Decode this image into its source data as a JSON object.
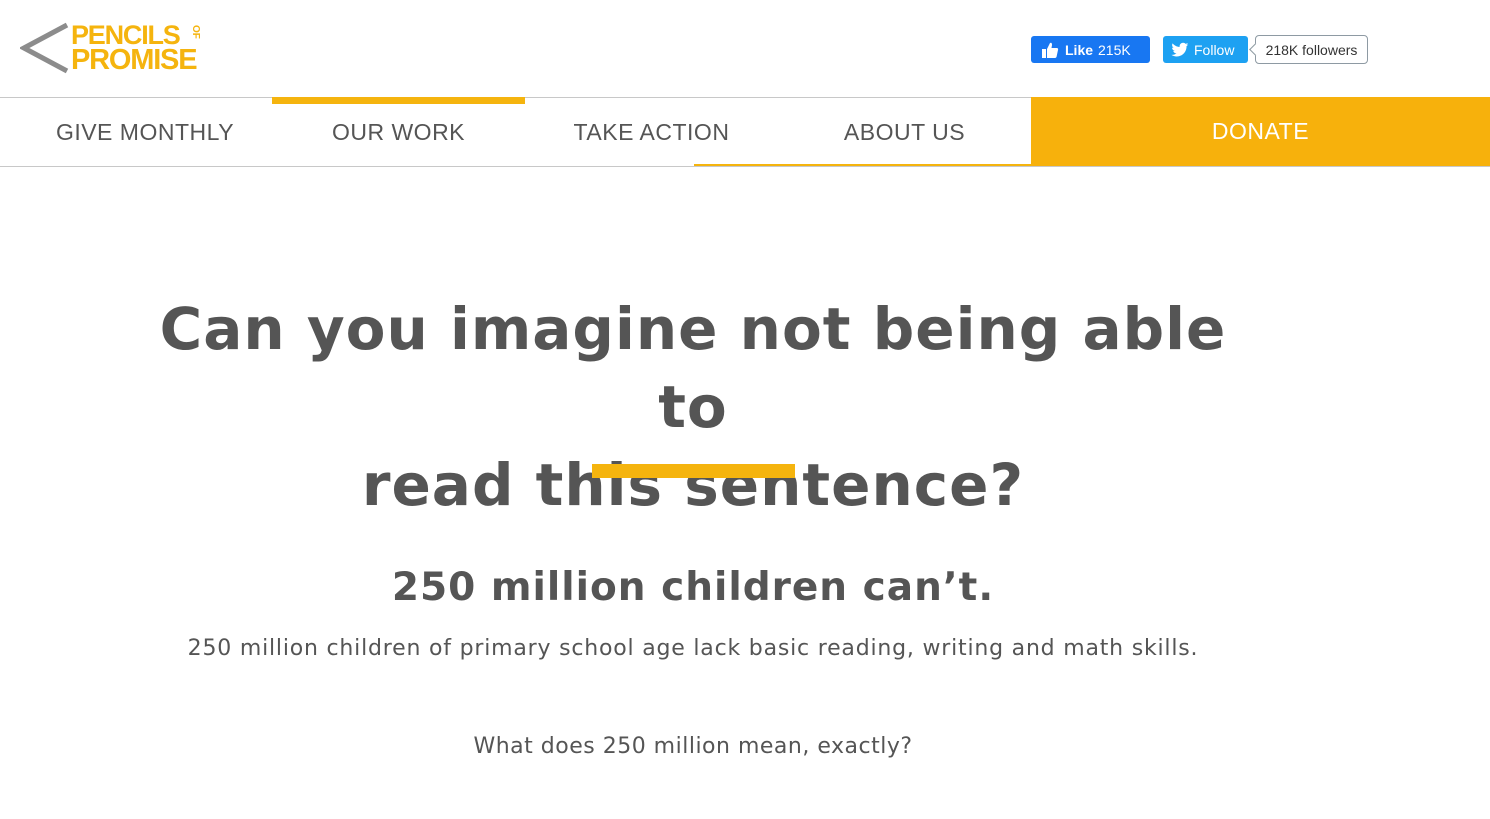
{
  "header": {
    "logo": {
      "line1": "PENCILS",
      "of": "OF",
      "line2": "PROMISE"
    },
    "facebook": {
      "label": "Like",
      "count": "215K"
    },
    "twitter": {
      "label": "Follow",
      "followers": "218K followers"
    }
  },
  "nav": {
    "items": [
      {
        "label": "GIVE MONTHLY"
      },
      {
        "label": "OUR WORK",
        "active": true
      },
      {
        "label": "TAKE ACTION"
      },
      {
        "label": "ABOUT US"
      }
    ],
    "donate": "DONATE"
  },
  "main": {
    "headline_line1": "Can you imagine not being able to",
    "headline_line2": "read this sentence?",
    "stat": "250 million children can’t.",
    "subtext": "250 million children of primary school age lack basic reading, writing and math skills.",
    "question": "What does 250 million mean, exactly?"
  },
  "colors": {
    "brand_yellow": "#f5b40e",
    "text_gray": "#555555",
    "facebook_blue": "#1877f2",
    "twitter_blue": "#1da1f2"
  }
}
